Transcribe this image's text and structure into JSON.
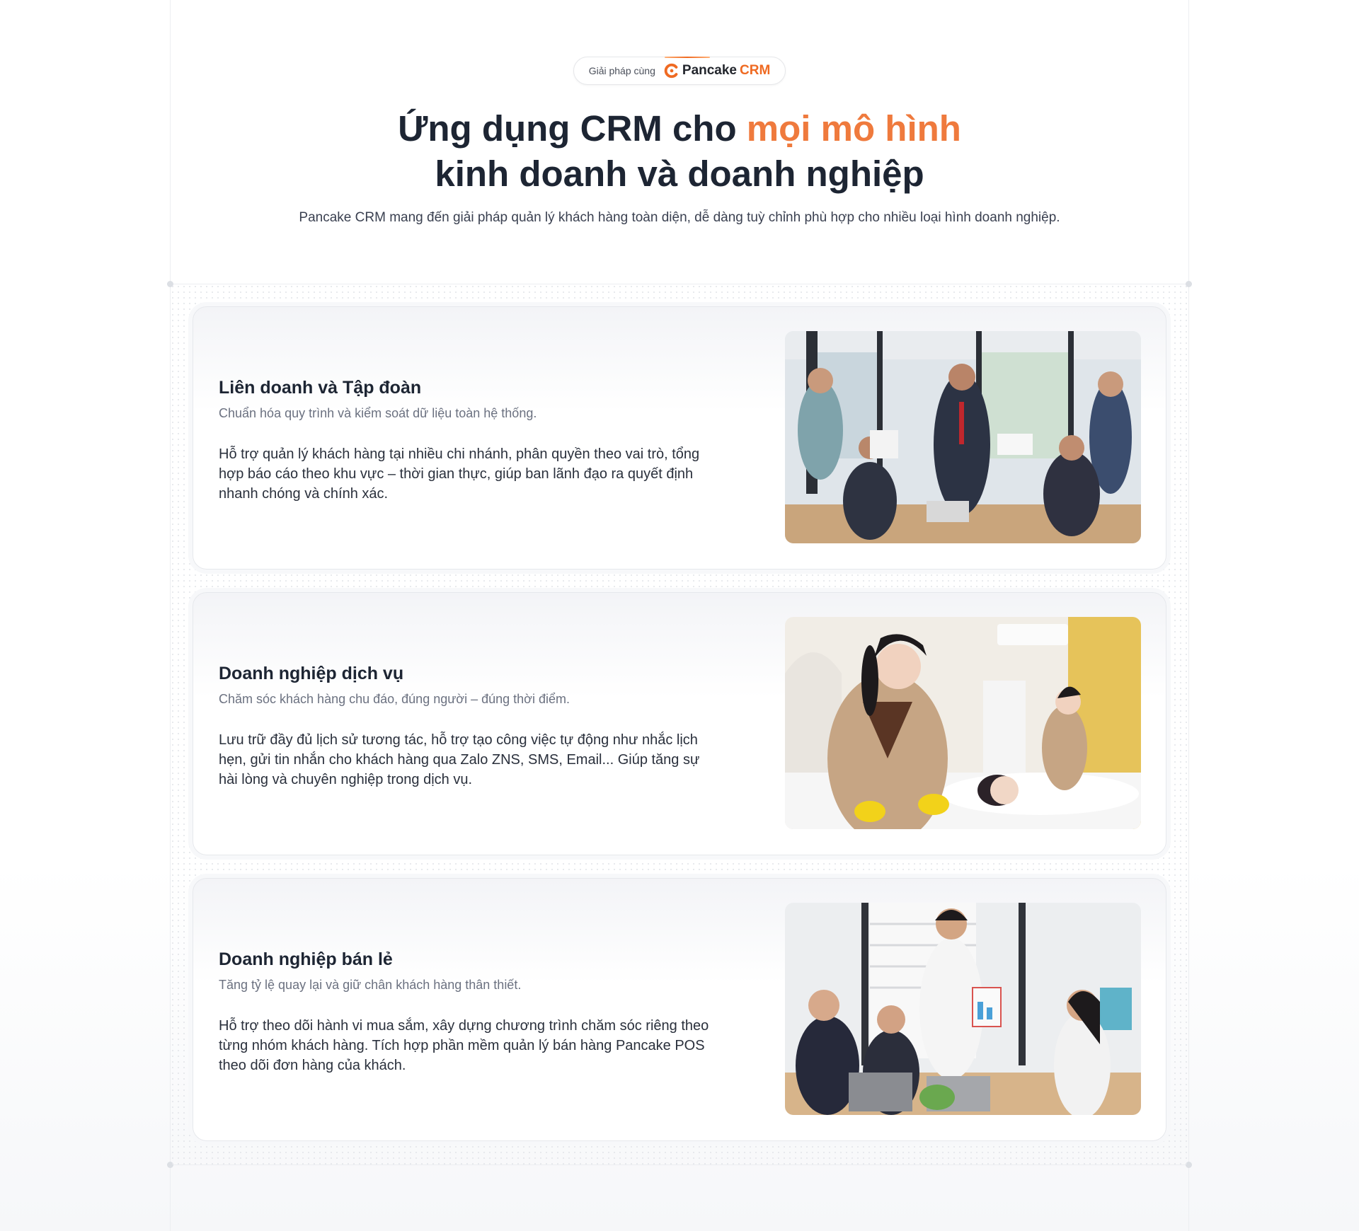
{
  "badge": {
    "label": "Giải pháp cùng",
    "brand_name": "Pancake",
    "brand_suffix": "CRM",
    "brand_color": "#ef6a22"
  },
  "headline": {
    "part1": "Ứng dụng CRM cho ",
    "highlight": "mọi mô hình",
    "line2": "kinh doanh và doanh nghiệp",
    "highlight_color": "#ef7a3d"
  },
  "subheadline": "Pancake CRM mang đến giải pháp quản lý khách hàng toàn diện, dễ dàng tuỳ chỉnh phù hợp cho nhiều loại hình doanh nghiệp.",
  "segments": [
    {
      "title": "Liên doanh và Tập đoàn",
      "tagline": "Chuẩn hóa quy trình và kiểm soát dữ liệu toàn hệ thống.",
      "description": "Hỗ trợ quản lý khách hàng tại nhiều chi nhánh, phân quyền theo vai trò, tổng hợp báo cáo theo khu vực – thời gian thực, giúp ban lãnh đạo ra quyết định nhanh chóng và chính xác.",
      "image": "corporate-meeting-photo"
    },
    {
      "title": "Doanh nghiệp dịch vụ",
      "tagline": "Chăm sóc khách hàng chu đáo, đúng người – đúng thời điểm.",
      "description": "Lưu trữ đầy đủ lịch sử tương tác, hỗ trợ tạo công việc tự động như nhắc lịch hẹn, gửi tin nhắn cho khách hàng qua Zalo ZNS, SMS, Email... Giúp tăng sự hài lòng và chuyên nghiệp trong dịch vụ.",
      "image": "spa-service-photo"
    },
    {
      "title": "Doanh nghiệp bán lẻ",
      "tagline": "Tăng tỷ lệ quay lại và giữ chân khách hàng thân thiết.",
      "description": "Hỗ trợ theo dõi hành vi mua sắm, xây dựng chương trình chăm sóc riêng theo từng nhóm khách hàng. Tích hợp phần mềm quản lý bán hàng Pancake POS theo dõi đơn hàng của khách.",
      "image": "retail-team-photo"
    }
  ]
}
